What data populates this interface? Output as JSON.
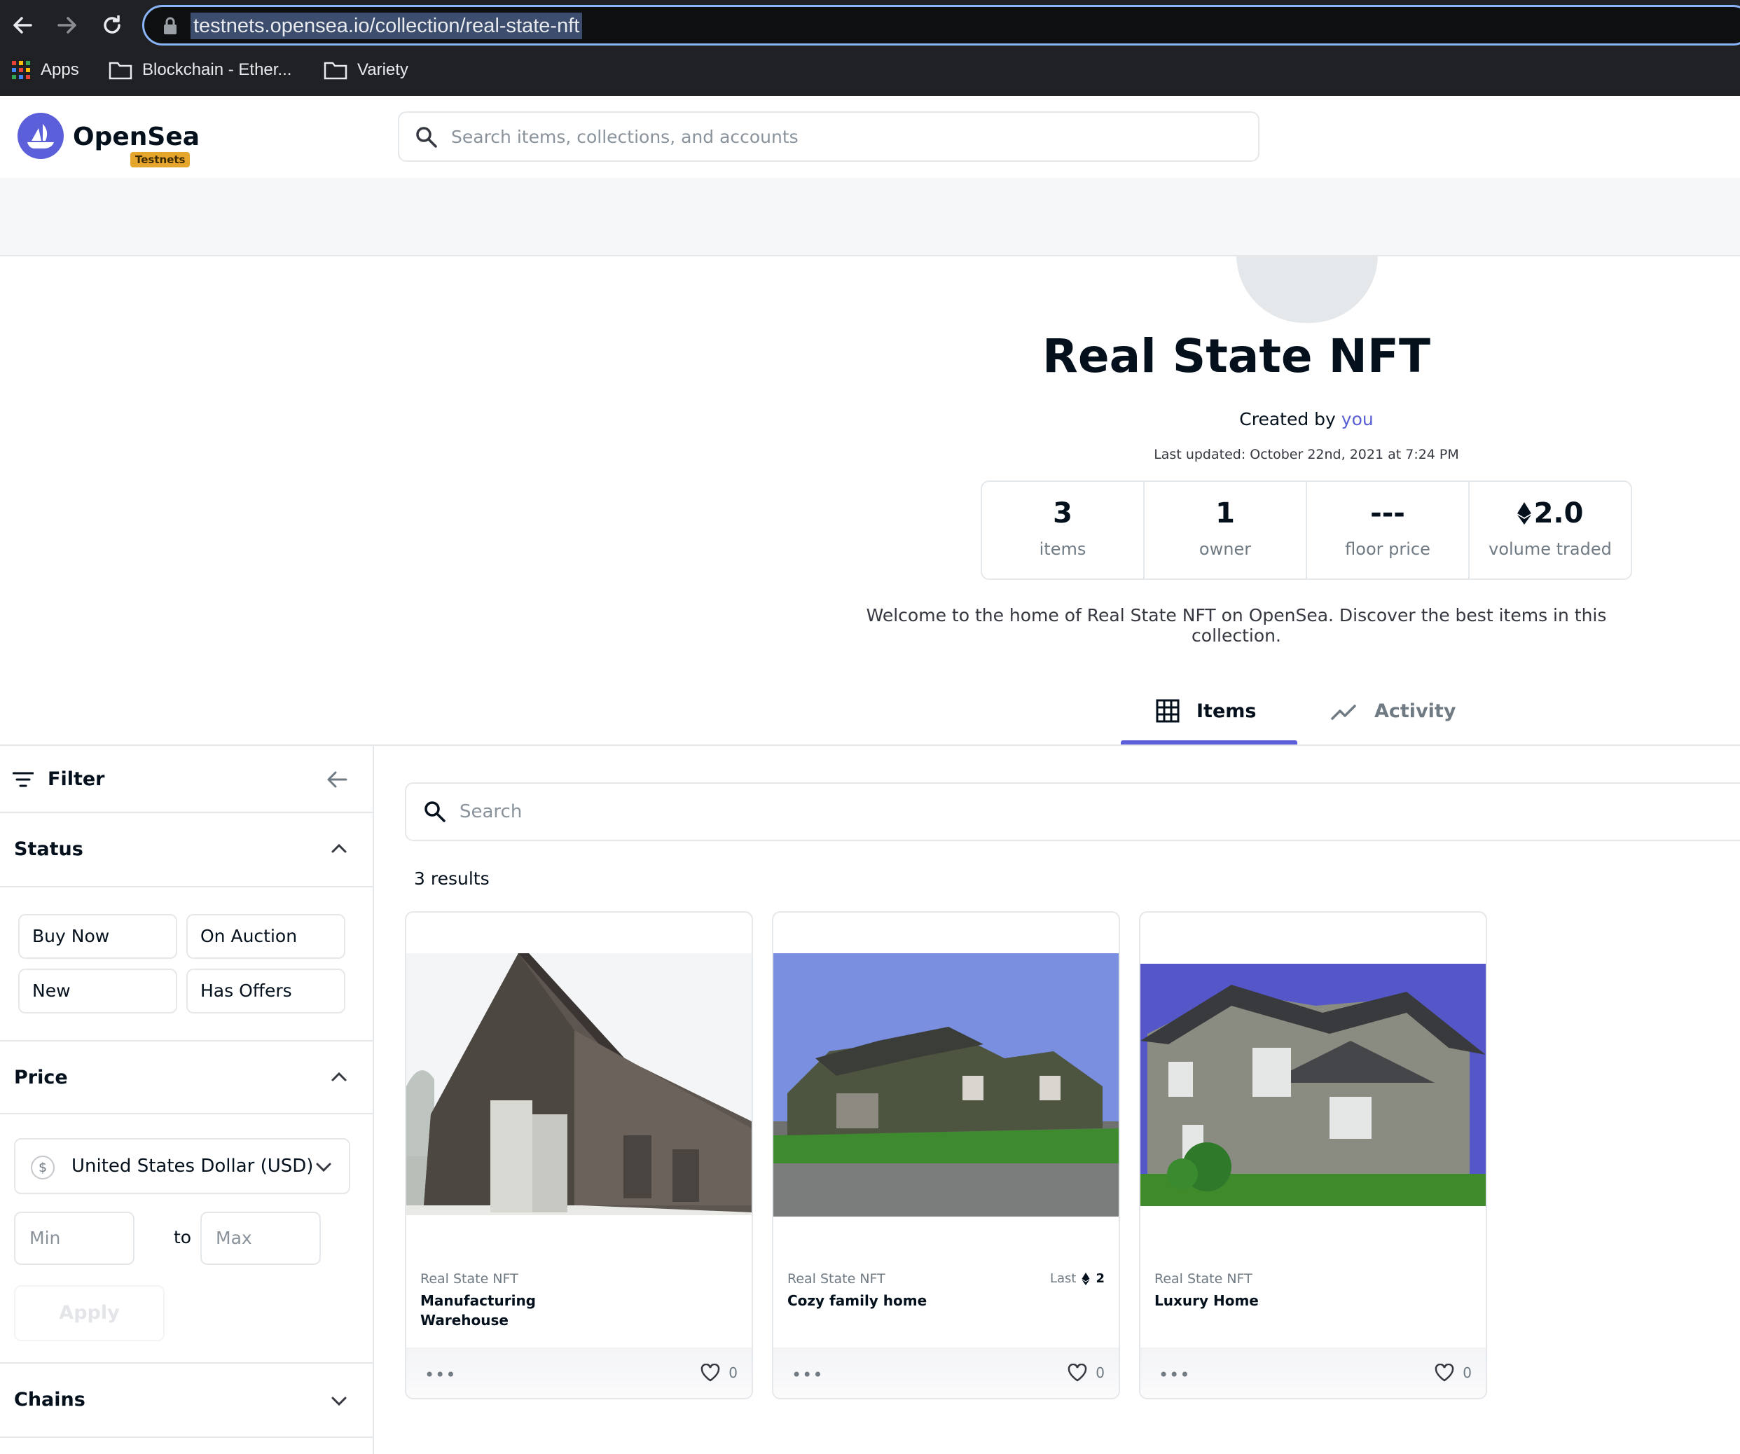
{
  "browser": {
    "url": "testnets.opensea.io/collection/real-state-nft",
    "bookmarks": [
      {
        "label": "Apps"
      },
      {
        "label": "Blockchain - Ether..."
      },
      {
        "label": "Variety"
      }
    ]
  },
  "header": {
    "brand": "OpenSea",
    "badge": "Testnets",
    "search_placeholder": "Search items, collections, and accounts"
  },
  "collection": {
    "title": "Real State NFT",
    "created_by_prefix": "Created by",
    "created_by_user": "you",
    "last_updated": "Last updated: October 22nd, 2021 at 7:24 PM",
    "stats": [
      {
        "value": "3",
        "label": "items"
      },
      {
        "value": "1",
        "label": "owner"
      },
      {
        "value": "---",
        "label": "floor price"
      },
      {
        "value": "2.0",
        "label": "volume traded",
        "icon": "eth-icon"
      }
    ],
    "description": "Welcome to the home of Real State NFT on OpenSea. Discover the best items in this collection."
  },
  "tabs": [
    {
      "label": "Items",
      "icon": "grid-icon",
      "active": true
    },
    {
      "label": "Activity",
      "icon": "activity-icon",
      "active": false
    }
  ],
  "sidebar": {
    "filter_label": "Filter",
    "status_title": "Status",
    "status_options": [
      "Buy Now",
      "On Auction",
      "New",
      "Has Offers"
    ],
    "price_title": "Price",
    "currency": "United States Dollar (USD)",
    "currency_symbol": "$",
    "min_placeholder": "Min",
    "to_label": "to",
    "max_placeholder": "Max",
    "apply_label": "Apply",
    "chains_title": "Chains"
  },
  "main": {
    "search_placeholder": "Search",
    "results": "3 results",
    "items": [
      {
        "collection": "Real State NFT",
        "name": "Manufacturing Warehouse",
        "favorites": "0",
        "last_label": "",
        "last_value": ""
      },
      {
        "collection": "Real State NFT",
        "name": "Cozy family home",
        "favorites": "0",
        "last_label": "Last",
        "last_value": "2"
      },
      {
        "collection": "Real State NFT",
        "name": "Luxury Home",
        "favorites": "0",
        "last_label": "",
        "last_value": ""
      }
    ]
  },
  "colors": {
    "accent": "#5b5fd9",
    "link": "#5a5fd6",
    "border": "#e5e8eb",
    "sky": "#7b8fe0"
  }
}
